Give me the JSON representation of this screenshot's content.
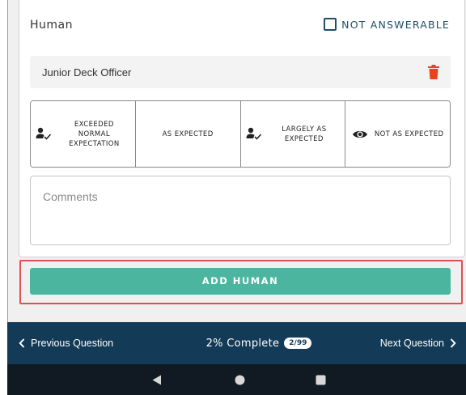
{
  "question": {
    "title": "Human",
    "not_answerable_label": "NOT ANSWERABLE"
  },
  "entry": {
    "label": "Junior Deck Officer"
  },
  "rating_options": [
    {
      "label": "EXCEEDED NORMAL EXPECTATION",
      "icon": "person-check-icon"
    },
    {
      "label": "AS EXPECTED",
      "icon": ""
    },
    {
      "label": "LARGELY AS EXPECTED",
      "icon": "person-check-icon"
    },
    {
      "label": "NOT AS EXPECTED",
      "icon": "eye-icon"
    }
  ],
  "comments": {
    "placeholder": "Comments"
  },
  "add_button": {
    "label": "ADD HUMAN"
  },
  "footer": {
    "previous_label": "Previous Question",
    "progress_label": "2% Complete",
    "progress_badge": "2/99",
    "next_label": "Next Question"
  },
  "colors": {
    "primary": "#1d4e6b",
    "accent": "#4bb5a0",
    "delete": "#e8431c",
    "nav_bar": "#133a56",
    "highlight": "#e05050"
  }
}
